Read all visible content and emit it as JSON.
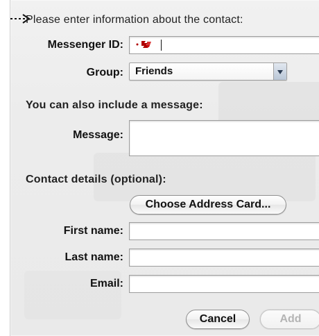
{
  "form": {
    "intro": "Please enter information about the contact:",
    "messenger": {
      "label": "Messenger ID:",
      "value": "",
      "icon": "messenger-id-icon"
    },
    "group": {
      "label": "Group:",
      "selected": "Friends",
      "icon": "chevron-down-icon"
    },
    "message_section": {
      "intro": "You can also include a message:",
      "label": "Message:"
    },
    "contact_details": {
      "intro": "Contact details (optional):",
      "choose_button": "Choose Address Card...",
      "first_name": {
        "label": "First name:"
      },
      "last_name": {
        "label": "Last name:"
      },
      "email": {
        "label": "Email:"
      }
    }
  },
  "buttons": {
    "cancel": "Cancel",
    "add": "Add"
  },
  "colors": {
    "messenger_icon_red": "#b00000",
    "select_arrow_blue": "#2a3b52"
  }
}
